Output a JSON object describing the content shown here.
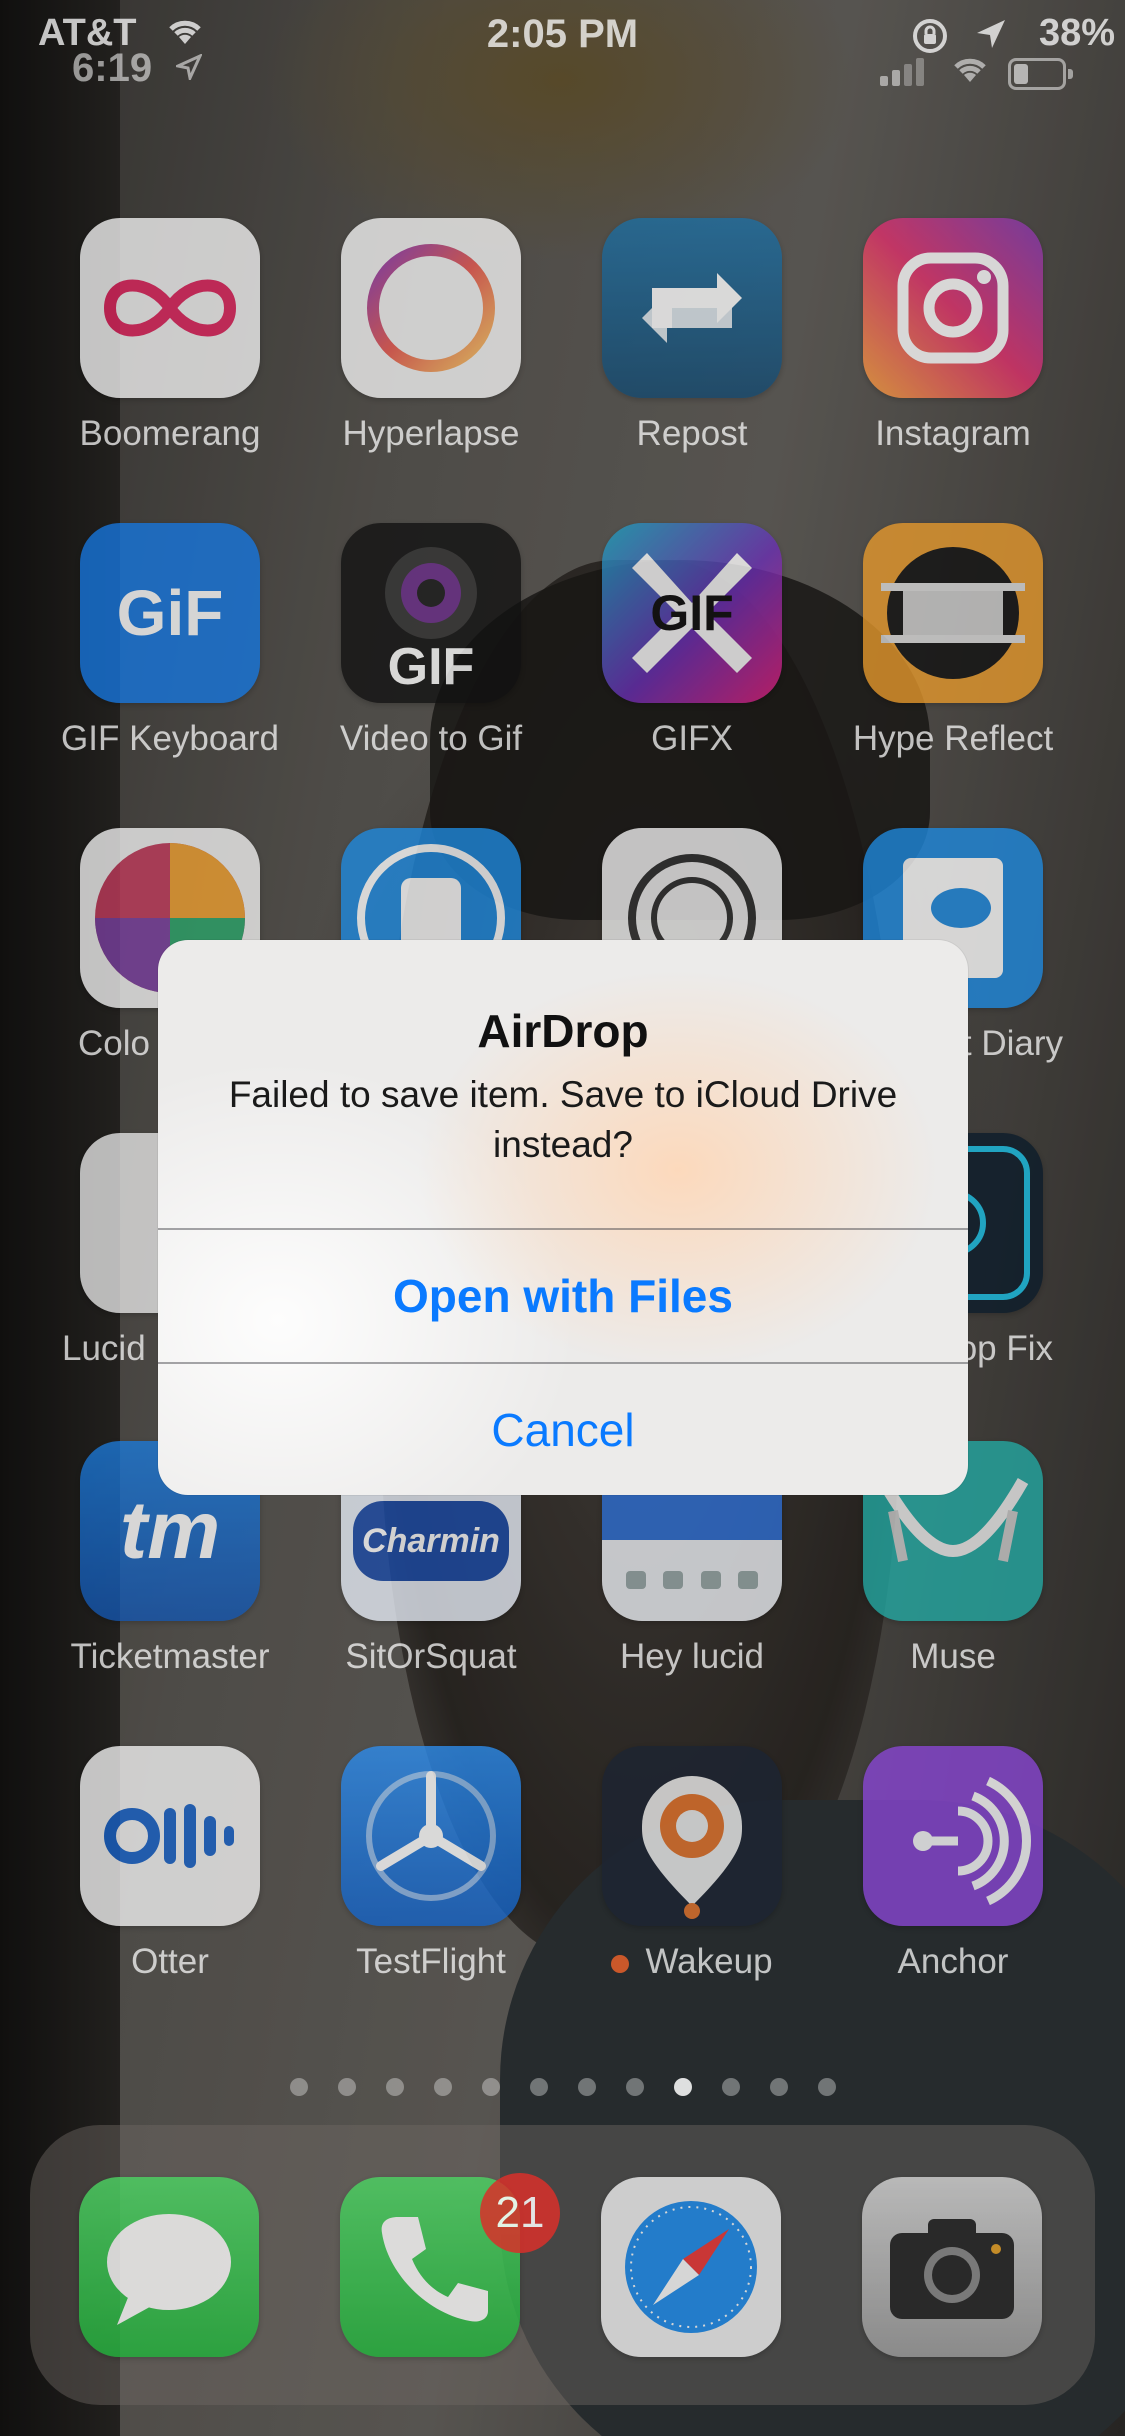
{
  "status_bar": {
    "carrier": "AT&T",
    "time_small": "6:19",
    "time": "2:05 PM",
    "battery": "38%"
  },
  "apps": {
    "row1": [
      {
        "label": "Boomerang",
        "icon": "boomerang-icon"
      },
      {
        "label": "Hyperlapse",
        "icon": "hyperlapse-icon"
      },
      {
        "label": "Repost",
        "icon": "repost-icon"
      },
      {
        "label": "Instagram",
        "icon": "instagram-icon"
      }
    ],
    "row2": [
      {
        "label": "GIF Keyboard",
        "icon": "gif-keyboard-icon",
        "glyph": "GiF"
      },
      {
        "label": "Video to Gif",
        "icon": "video-to-gif-icon",
        "glyph": "GIF"
      },
      {
        "label": "GIFX",
        "icon": "gifx-icon",
        "glyph": "GIF"
      },
      {
        "label": "Hype Reflect",
        "icon": "hype-reflect-icon"
      }
    ],
    "row3": [
      {
        "label": "Colo",
        "icon": "color-wheel-icon"
      },
      {
        "label": "",
        "icon": "speaker-icon"
      },
      {
        "label": "",
        "icon": "aperture-icon"
      },
      {
        "label": "t Diary",
        "icon": "diary-icon"
      }
    ],
    "row4": [
      {
        "label": "Lucid",
        "icon": "lucid-icon"
      },
      {
        "label": "op Fix",
        "icon": "photoshop-fix-icon"
      }
    ],
    "row5": [
      {
        "label": "Ticketmaster",
        "icon": "ticketmaster-icon",
        "glyph": "tm"
      },
      {
        "label": "SitOrSquat",
        "icon": "sitorsquat-icon",
        "glyph": "Charmin"
      },
      {
        "label": "Hey lucid",
        "icon": "hey-lucid-icon"
      },
      {
        "label": "Muse",
        "icon": "muse-icon"
      }
    ],
    "row6": [
      {
        "label": "Otter",
        "icon": "otter-icon"
      },
      {
        "label": "TestFlight",
        "icon": "testflight-icon"
      },
      {
        "label": "Wakeup",
        "icon": "wakeup-icon"
      },
      {
        "label": "Anchor",
        "icon": "anchor-icon"
      }
    ]
  },
  "page_dots": {
    "count": 12,
    "active_index": 8
  },
  "dock": [
    {
      "icon": "messages-icon"
    },
    {
      "icon": "phone-icon",
      "badge": "21"
    },
    {
      "icon": "safari-icon"
    },
    {
      "icon": "camera-icon"
    }
  ],
  "alert": {
    "title": "AirDrop",
    "message": "Failed to save item. Save to iCloud Drive instead?",
    "primary_button": "Open with Files",
    "cancel_button": "Cancel"
  }
}
